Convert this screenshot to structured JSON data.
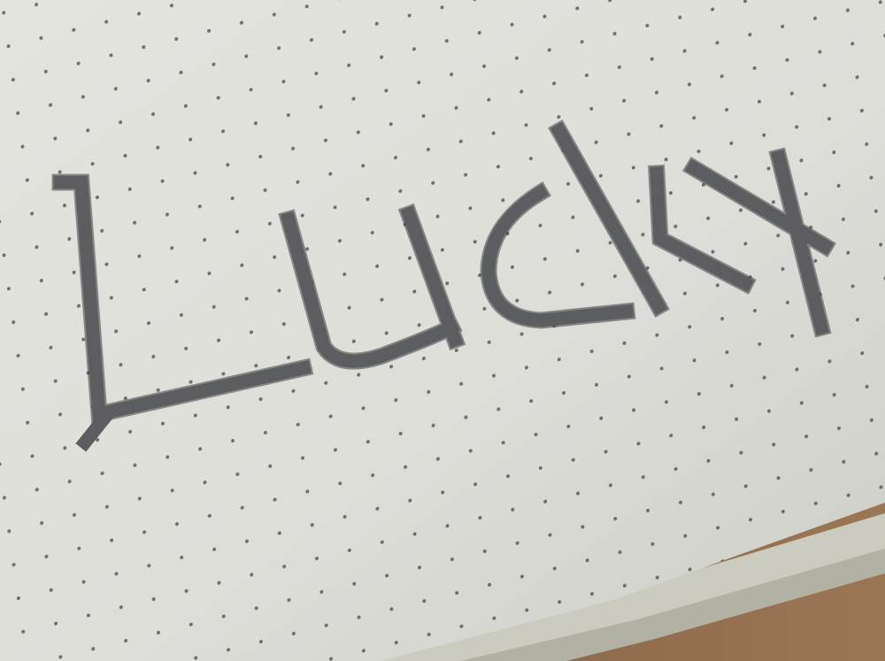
{
  "photo": {
    "handwritten_word": "Lucky",
    "colors": {
      "paper": "#e9e9e4",
      "paper_shadow": "#c9cac4",
      "paper_edge": "#d3d2c6",
      "table": "#8a6a4e",
      "ink": "#5f6064",
      "dot": "#4a4a48"
    }
  }
}
